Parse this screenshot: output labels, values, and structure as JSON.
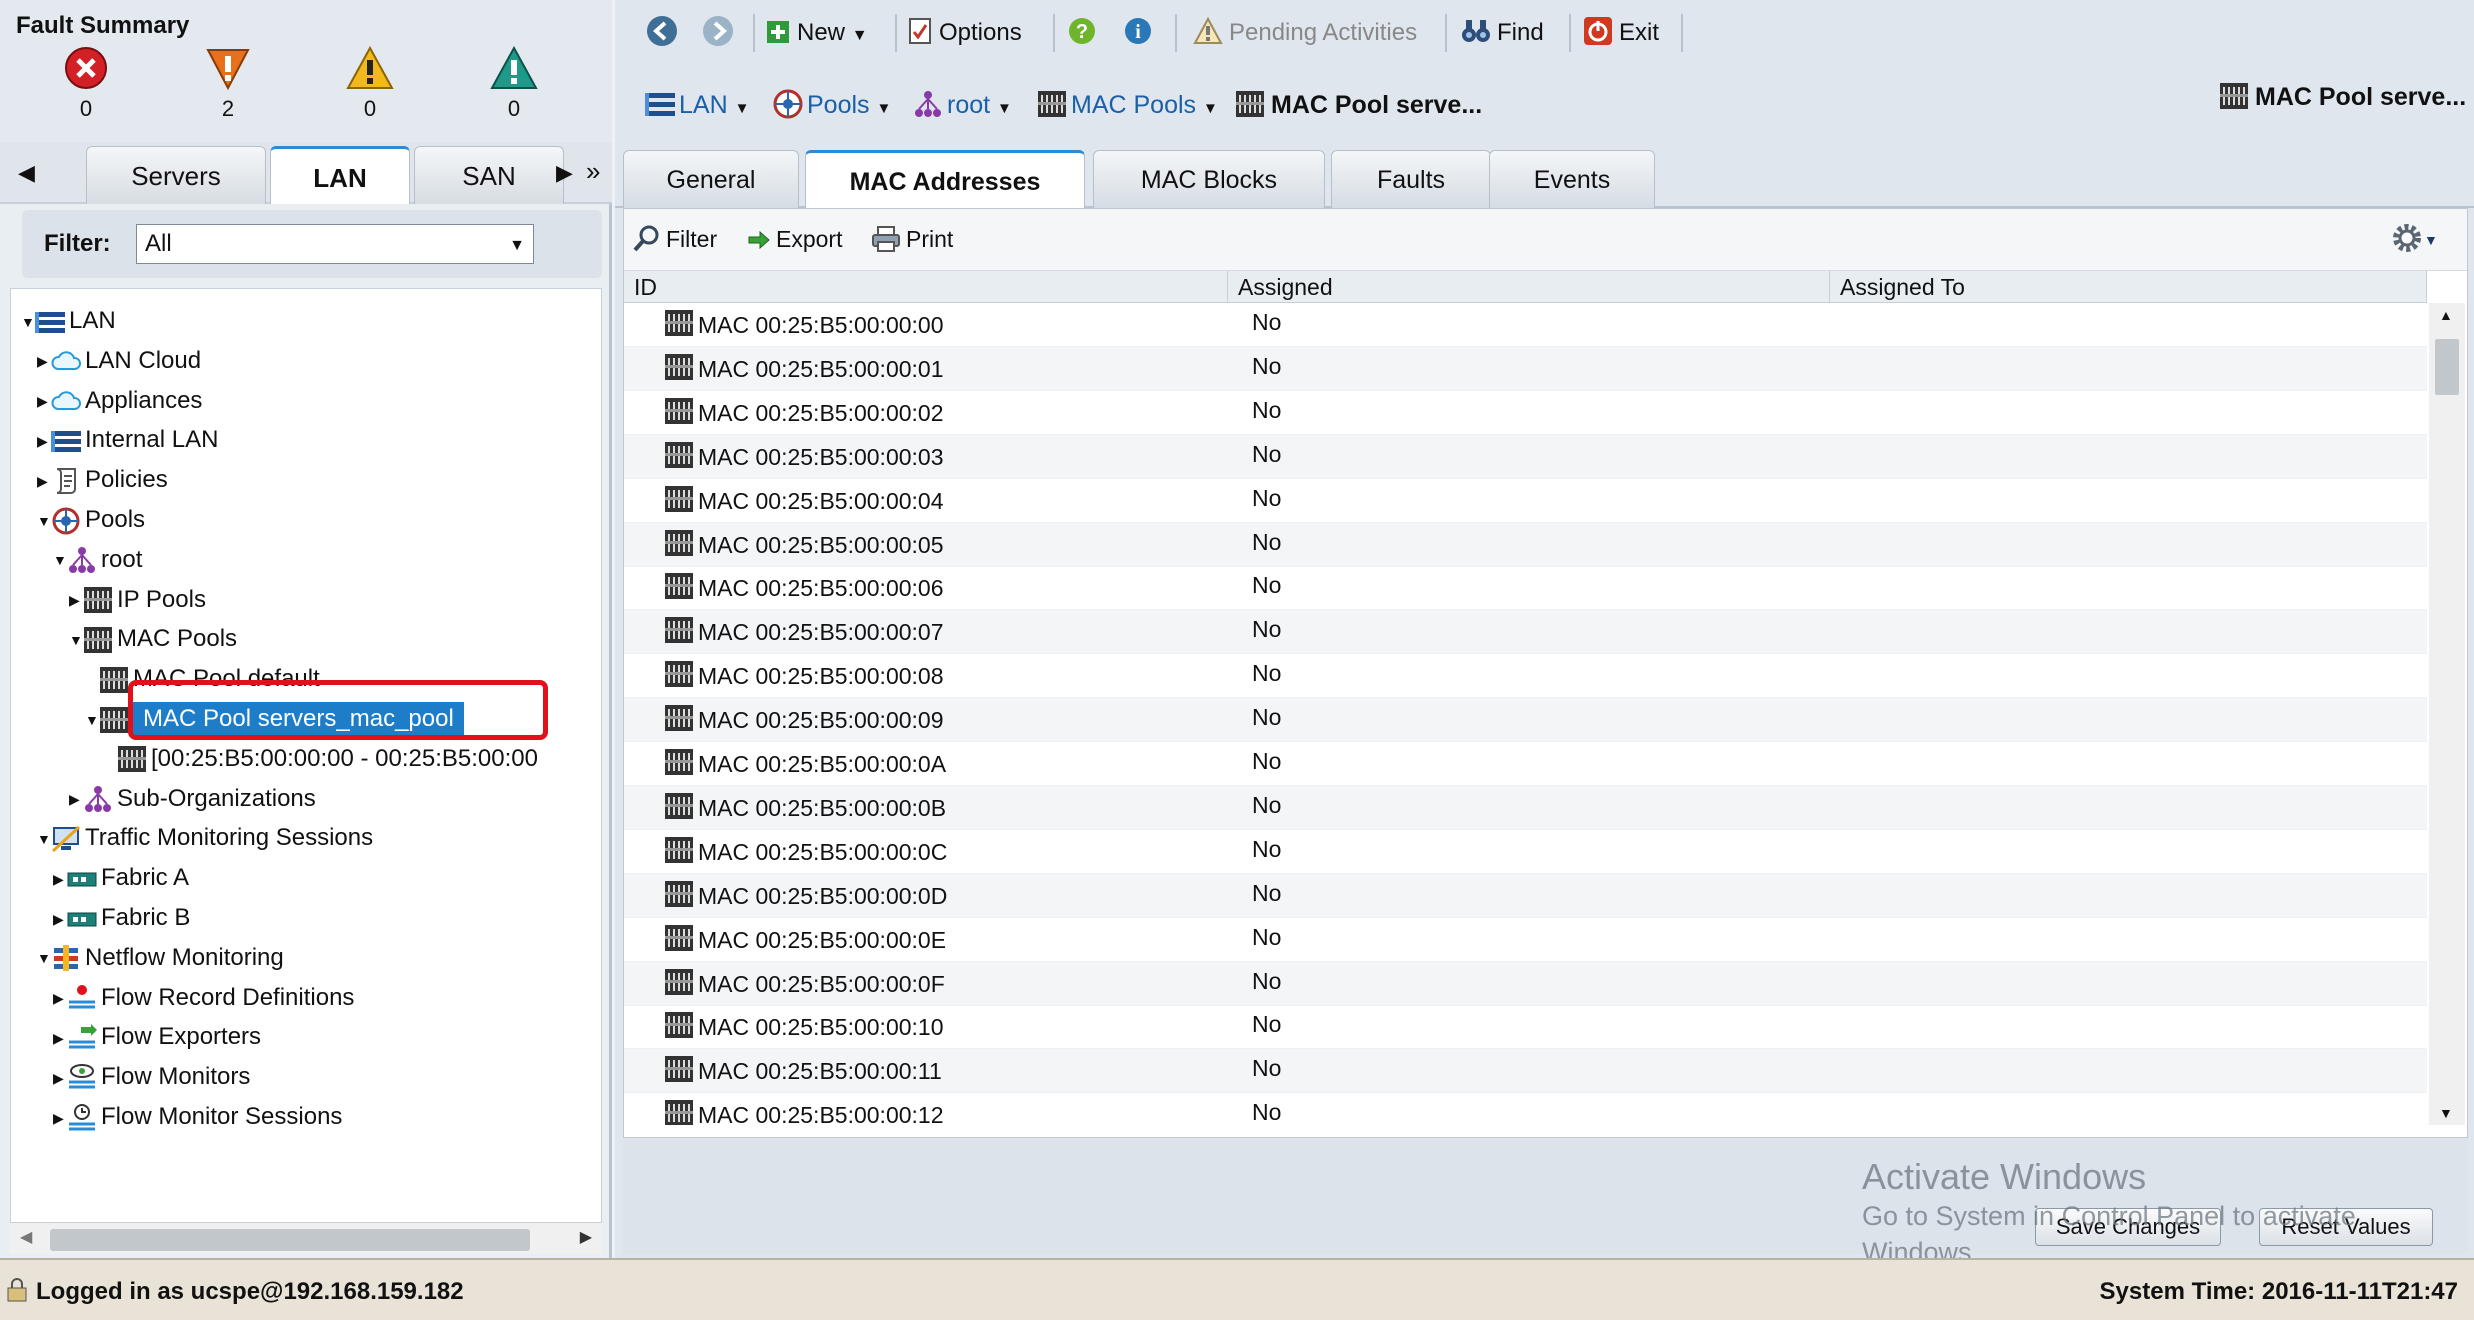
{
  "fault_summary": {
    "title": "Fault Summary",
    "counts": [
      {
        "severity": "critical",
        "icon": "critical-fault-icon",
        "count": "0",
        "color": "#d32027"
      },
      {
        "severity": "major",
        "icon": "major-fault-icon",
        "count": "2",
        "color": "#e8701a"
      },
      {
        "severity": "minor",
        "icon": "minor-fault-icon",
        "count": "0",
        "color": "#f2b81c"
      },
      {
        "severity": "warning",
        "icon": "warning-fault-icon",
        "count": "0",
        "color": "#1f9a8a"
      }
    ]
  },
  "left_tabs": {
    "items": [
      "Servers",
      "LAN",
      "SAN"
    ],
    "active": "LAN",
    "more": "»"
  },
  "filter": {
    "label": "Filter:",
    "value": "All"
  },
  "tree": [
    {
      "label": "LAN",
      "level": 0,
      "expanded": true,
      "icon": "lan-icon"
    },
    {
      "label": "LAN Cloud",
      "level": 1,
      "expanded": false,
      "icon": "cloud-icon"
    },
    {
      "label": "Appliances",
      "level": 1,
      "expanded": false,
      "icon": "cloud-icon"
    },
    {
      "label": "Internal LAN",
      "level": 1,
      "expanded": false,
      "icon": "lan-icon"
    },
    {
      "label": "Policies",
      "level": 1,
      "expanded": false,
      "icon": "policy-icon"
    },
    {
      "label": "Pools",
      "level": 1,
      "expanded": true,
      "icon": "pools-icon"
    },
    {
      "label": "root",
      "level": 2,
      "expanded": true,
      "icon": "org-icon"
    },
    {
      "label": "IP Pools",
      "level": 3,
      "expanded": false,
      "icon": "pool-block-icon"
    },
    {
      "label": "MAC Pools",
      "level": 3,
      "expanded": true,
      "icon": "pool-block-icon"
    },
    {
      "label": "MAC Pool default",
      "level": 4,
      "leaf": true,
      "icon": "pool-block-icon"
    },
    {
      "label": "MAC Pool servers_mac_pool",
      "level": 4,
      "expanded": true,
      "icon": "pool-block-icon",
      "selected": true
    },
    {
      "label": "[00:25:B5:00:00:00 - 00:25:B5:00:00",
      "level": 5,
      "leaf": true,
      "icon": "pool-block-icon"
    },
    {
      "label": "Sub-Organizations",
      "level": 3,
      "expanded": false,
      "icon": "org-icon"
    },
    {
      "label": "Traffic Monitoring Sessions",
      "level": 1,
      "expanded": true,
      "icon": "monitor-icon"
    },
    {
      "label": "Fabric A",
      "level": 2,
      "expanded": false,
      "icon": "fabric-icon"
    },
    {
      "label": "Fabric B",
      "level": 2,
      "expanded": false,
      "icon": "fabric-icon"
    },
    {
      "label": "Netflow Monitoring",
      "level": 1,
      "expanded": true,
      "icon": "netflow-icon"
    },
    {
      "label": "Flow Record Definitions",
      "level": 2,
      "expanded": false,
      "icon": "flow-record-icon"
    },
    {
      "label": "Flow Exporters",
      "level": 2,
      "expanded": false,
      "icon": "flow-exporter-icon"
    },
    {
      "label": "Flow Monitors",
      "level": 2,
      "expanded": false,
      "icon": "flow-monitor-icon"
    },
    {
      "label": "Flow Monitor Sessions",
      "level": 2,
      "expanded": false,
      "icon": "flow-session-icon"
    }
  ],
  "toolbar": {
    "new": "New",
    "options": "Options",
    "pending": "Pending Activities",
    "find": "Find",
    "exit": "Exit"
  },
  "nav": {
    "crumbs": [
      "LAN",
      "Pools",
      "root",
      "MAC Pools"
    ],
    "current": "MAC Pool serve...",
    "right_title": "MAC Pool serve..."
  },
  "right_tabs": {
    "items": [
      "General",
      "MAC Addresses",
      "MAC Blocks",
      "Faults",
      "Events"
    ],
    "active": "MAC Addresses"
  },
  "content_toolbar": {
    "filter": "Filter",
    "export": "Export",
    "print": "Print"
  },
  "table": {
    "columns": [
      "ID",
      "Assigned",
      "Assigned To"
    ],
    "rows": [
      {
        "id": "MAC 00:25:B5:00:00:00",
        "assigned": "No",
        "assigned_to": ""
      },
      {
        "id": "MAC 00:25:B5:00:00:01",
        "assigned": "No",
        "assigned_to": ""
      },
      {
        "id": "MAC 00:25:B5:00:00:02",
        "assigned": "No",
        "assigned_to": ""
      },
      {
        "id": "MAC 00:25:B5:00:00:03",
        "assigned": "No",
        "assigned_to": ""
      },
      {
        "id": "MAC 00:25:B5:00:00:04",
        "assigned": "No",
        "assigned_to": ""
      },
      {
        "id": "MAC 00:25:B5:00:00:05",
        "assigned": "No",
        "assigned_to": ""
      },
      {
        "id": "MAC 00:25:B5:00:00:06",
        "assigned": "No",
        "assigned_to": ""
      },
      {
        "id": "MAC 00:25:B5:00:00:07",
        "assigned": "No",
        "assigned_to": ""
      },
      {
        "id": "MAC 00:25:B5:00:00:08",
        "assigned": "No",
        "assigned_to": ""
      },
      {
        "id": "MAC 00:25:B5:00:00:09",
        "assigned": "No",
        "assigned_to": ""
      },
      {
        "id": "MAC 00:25:B5:00:00:0A",
        "assigned": "No",
        "assigned_to": ""
      },
      {
        "id": "MAC 00:25:B5:00:00:0B",
        "assigned": "No",
        "assigned_to": ""
      },
      {
        "id": "MAC 00:25:B5:00:00:0C",
        "assigned": "No",
        "assigned_to": ""
      },
      {
        "id": "MAC 00:25:B5:00:00:0D",
        "assigned": "No",
        "assigned_to": ""
      },
      {
        "id": "MAC 00:25:B5:00:00:0E",
        "assigned": "No",
        "assigned_to": ""
      },
      {
        "id": "MAC 00:25:B5:00:00:0F",
        "assigned": "No",
        "assigned_to": ""
      },
      {
        "id": "MAC 00:25:B5:00:00:10",
        "assigned": "No",
        "assigned_to": ""
      },
      {
        "id": "MAC 00:25:B5:00:00:11",
        "assigned": "No",
        "assigned_to": ""
      },
      {
        "id": "MAC 00:25:B5:00:00:12",
        "assigned": "No",
        "assigned_to": ""
      }
    ]
  },
  "footer": {
    "save": "Save Changes",
    "reset": "Reset Values"
  },
  "watermark": {
    "line1": "Activate Windows",
    "line2": "Go to System in Control Panel to activate",
    "line3": "Windows."
  },
  "status": {
    "left": "Logged in as ucspe@192.168.159.182",
    "right": "System Time: 2016-11-11T21:47"
  },
  "colors": {
    "accent": "#1d7dc8",
    "highlight": "#e0111b"
  }
}
